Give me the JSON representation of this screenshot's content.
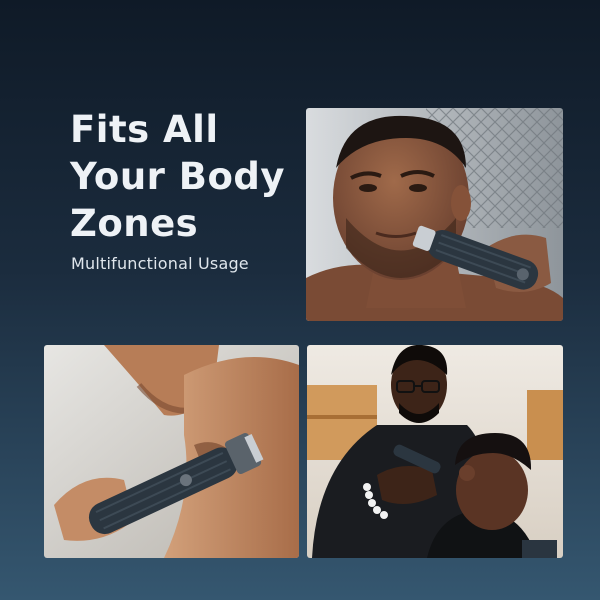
{
  "headline": {
    "lines": [
      "Fits All",
      "Your Body",
      "Zones"
    ]
  },
  "subtitle": "Multifunctional Usage",
  "photos": [
    {
      "label": "man-trimming-beard-photo"
    },
    {
      "label": "man-trimming-underarm-photo"
    },
    {
      "label": "barber-trimming-client-photo"
    }
  ],
  "colors": {
    "background_top": "#0f1a27",
    "background_bottom": "#355770",
    "text": "#eef2f6",
    "trimmer_body": "#2b3640",
    "trimmer_accent": "#c9ced3"
  }
}
